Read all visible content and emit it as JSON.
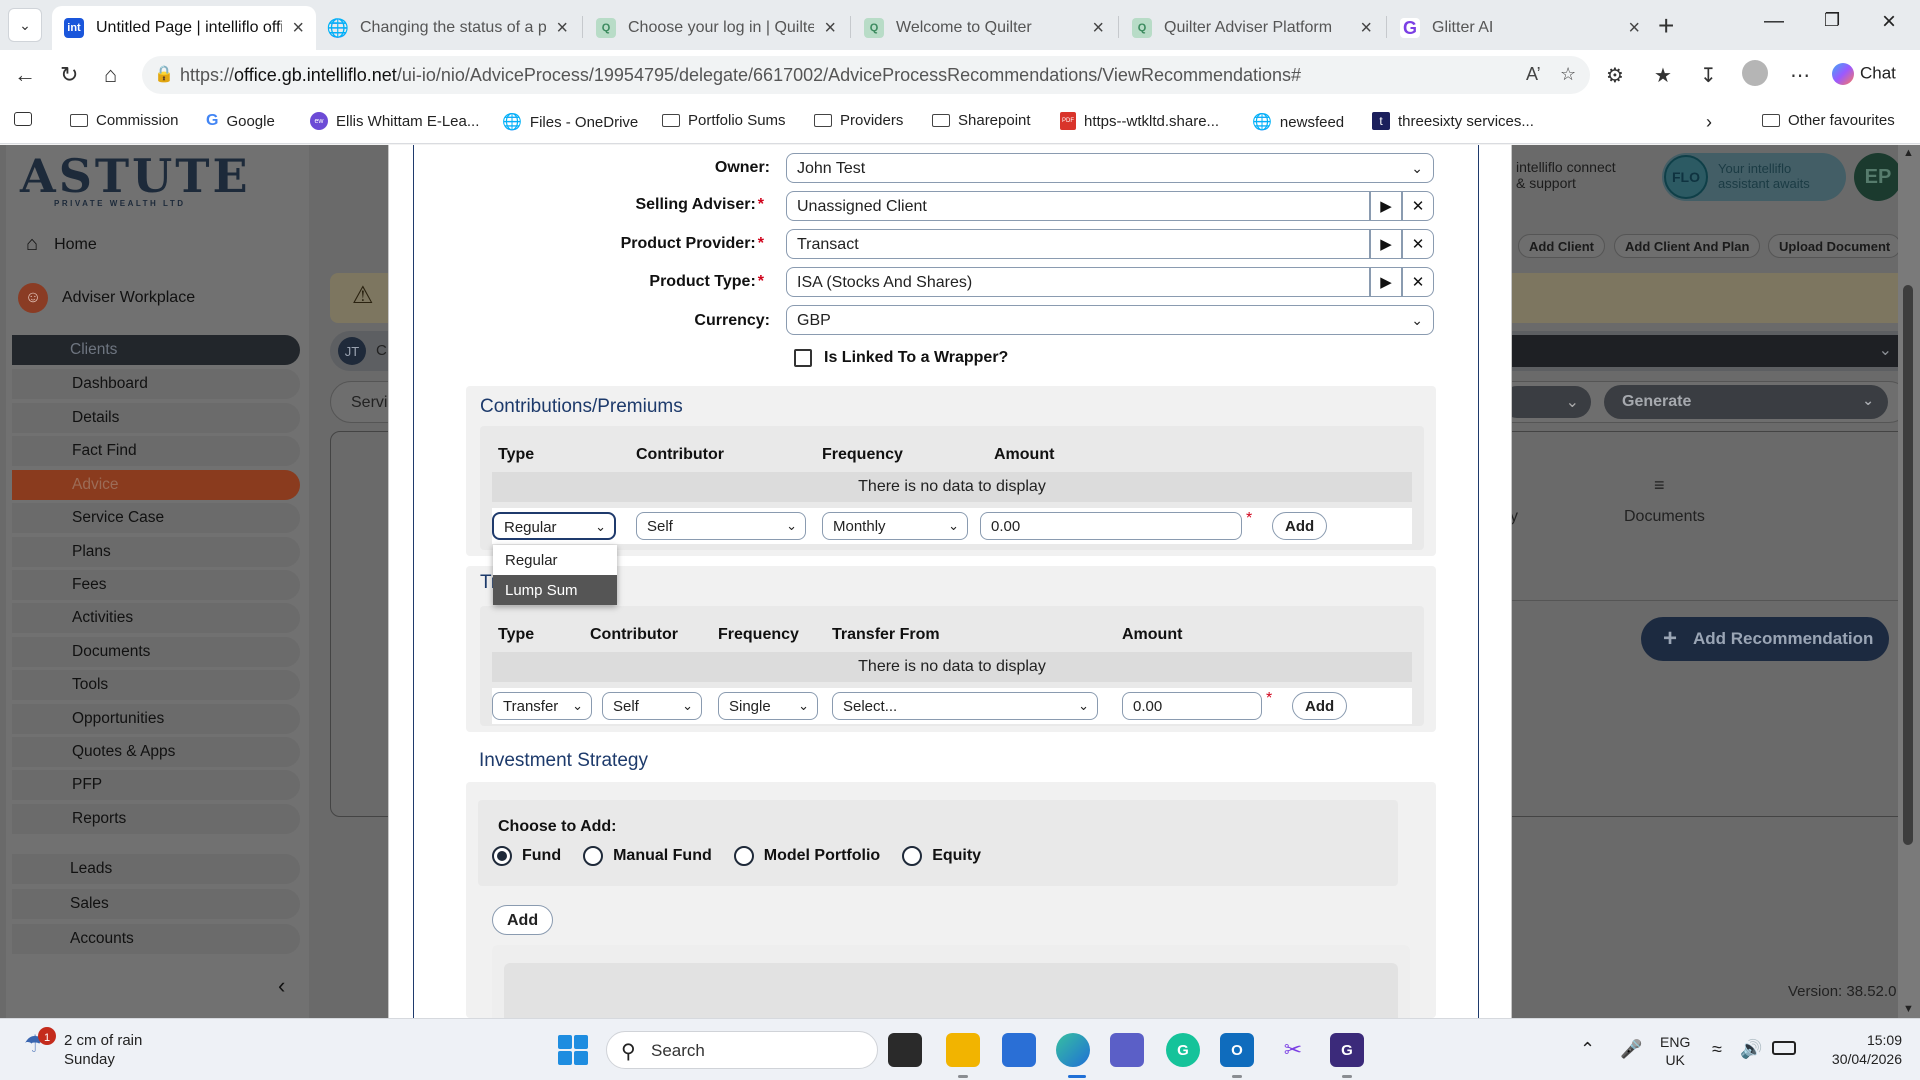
{
  "browser": {
    "tabs": [
      {
        "title": "Untitled Page | intelliflo office",
        "active": true,
        "favicon_color": "#1a56db"
      },
      {
        "title": "Changing the status of a plan",
        "active": false,
        "favicon_color": "#555555"
      },
      {
        "title": "Choose your log in | Quilter",
        "active": false,
        "favicon_color": "#7bbf9a"
      },
      {
        "title": "Welcome to Quilter",
        "active": false,
        "favicon_color": "#7bbf9a"
      },
      {
        "title": "Quilter Adviser Platform",
        "active": false,
        "favicon_color": "#7bbf9a"
      },
      {
        "title": "Glitter AI",
        "active": false,
        "favicon_color": "#7b3fe4"
      }
    ],
    "url_prefix": "https://",
    "url_domain": "office.gb.intelliflo.net",
    "url_path": "/ui-io/nio/AdviceProcess/19954795/delegate/6617002/AdviceProcessRecommendations/ViewRecommendations#",
    "chat_label": "Chat",
    "bookmarks": [
      {
        "label": "Commission",
        "icon": "folder-icon"
      },
      {
        "label": "Google",
        "icon": "google-icon"
      },
      {
        "label": "Ellis Whittam E-Lea...",
        "icon": "ellis-icon"
      },
      {
        "label": "Files - OneDrive",
        "icon": "globe-icon"
      },
      {
        "label": "Portfolio Sums",
        "icon": "folder-icon"
      },
      {
        "label": "Providers",
        "icon": "folder-icon"
      },
      {
        "label": "Sharepoint",
        "icon": "folder-icon"
      },
      {
        "label": "https--wtkltd.share...",
        "icon": "pdf-icon"
      },
      {
        "label": "newsfeed",
        "icon": "globe-icon"
      },
      {
        "label": "threesixty services...",
        "icon": "threesixty-icon"
      }
    ],
    "other_favourites": "Other favourites"
  },
  "app": {
    "logo_main": "ASTUTE",
    "logo_sub": "PRIVATE WEALTH LTD",
    "home_label": "Home",
    "workplace_label": "Adviser Workplace",
    "nav_items": [
      "Clients",
      "Dashboard",
      "Details",
      "Fact Find",
      "Advice",
      "Service Case",
      "Plans",
      "Fees",
      "Activities",
      "Documents",
      "Tools",
      "Opportunities",
      "Quotes & Apps",
      "PFP",
      "Reports"
    ],
    "nav_groups": [
      "Leads",
      "Sales",
      "Accounts"
    ],
    "client_initials": "JT",
    "client_partial": "C",
    "serv_partial": "Servi",
    "partial_tab_letter": "y",
    "connect_label_1": "intelliflo connect",
    "connect_label_2": "& support",
    "flo_badge": "FLO",
    "flo_text_1": "Your intelliflo",
    "flo_text_2": "assistant awaits",
    "user_initials": "EP",
    "action_chips": [
      "Add Client",
      "Add Client And Plan",
      "Upload Document"
    ],
    "generate_label": "Generate",
    "documents_label": "Documents",
    "add_recommendation_label": "Add Recommendation",
    "version_label": "Version: 38.52.0"
  },
  "form": {
    "owner_label": "Owner:",
    "owner_value": "John Test",
    "selling_adviser_label": "Selling Adviser:",
    "selling_adviser_value": "Unassigned Client",
    "product_provider_label": "Product Provider:",
    "product_provider_value": "Transact",
    "product_type_label": "Product Type:",
    "product_type_value": "ISA (Stocks And Shares)",
    "currency_label": "Currency:",
    "currency_value": "GBP",
    "linked_wrapper_label": "Is Linked To a Wrapper?",
    "contributions": {
      "title": "Contributions/Premiums",
      "headers": [
        "Type",
        "Contributor",
        "Frequency",
        "Amount"
      ],
      "no_data": "There is no data to display",
      "type_value": "Regular",
      "contributor_value": "Self",
      "frequency_value": "Monthly",
      "amount_value": "0.00",
      "add_label": "Add",
      "type_options": [
        "Regular",
        "Lump Sum"
      ]
    },
    "transfers": {
      "title_partial": "Tr",
      "headers": [
        "Type",
        "Contributor",
        "Frequency",
        "Transfer From",
        "Amount"
      ],
      "no_data": "There is no data to display",
      "type_value": "Transfer",
      "contributor_value": "Self",
      "frequency_value": "Single",
      "transfer_from_value": "Select...",
      "amount_value": "0.00",
      "add_label": "Add"
    },
    "investment": {
      "title": "Investment Strategy",
      "choose_label": "Choose to Add:",
      "options": [
        "Fund",
        "Manual Fund",
        "Model Portfolio",
        "Equity"
      ],
      "selected": "Fund",
      "add_label": "Add"
    }
  },
  "taskbar": {
    "weather_badge": "1",
    "weather_line1": "2 cm of rain",
    "weather_line2": "Sunday",
    "search_label": "Search",
    "lang_line1": "ENG",
    "lang_line2": "UK",
    "time": "15:09",
    "date": "30/04/2026"
  }
}
